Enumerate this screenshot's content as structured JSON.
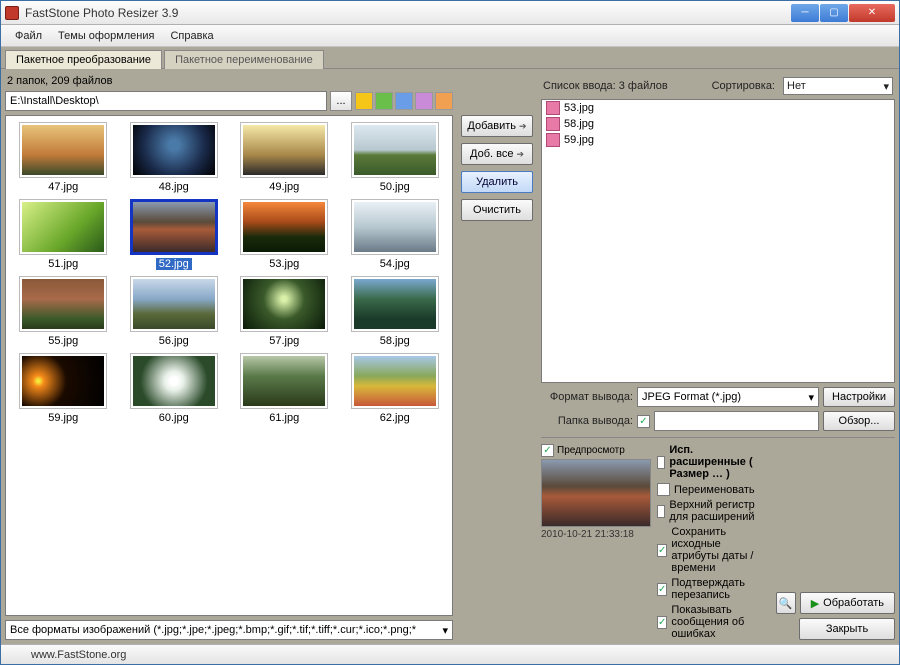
{
  "app": {
    "title": "FastStone Photo Resizer 3.9"
  },
  "menu": {
    "file": "Файл",
    "themes": "Темы оформления",
    "help": "Справка"
  },
  "tabs": {
    "batch_convert": "Пакетное преобразование",
    "batch_rename": "Пакетное переименование"
  },
  "left": {
    "folder_count": "2 папок, 209 файлов",
    "path": "E:\\Install\\Desktop\\",
    "browse_ellipsis": "...",
    "file_types": "Все форматы изображений (*.jpg;*.jpe;*.jpeg;*.bmp;*.gif;*.tif;*.tiff;*.cur;*.ico;*.png;*",
    "thumbs": [
      {
        "name": "47.jpg",
        "cls": "g-sunset1"
      },
      {
        "name": "48.jpg",
        "cls": "g-earth"
      },
      {
        "name": "49.jpg",
        "cls": "g-sky1"
      },
      {
        "name": "50.jpg",
        "cls": "g-field1"
      },
      {
        "name": "51.jpg",
        "cls": "g-leaf1"
      },
      {
        "name": "52.jpg",
        "cls": "g-mount",
        "selected": true
      },
      {
        "name": "53.jpg",
        "cls": "g-sunset2"
      },
      {
        "name": "54.jpg",
        "cls": "g-snow"
      },
      {
        "name": "55.jpg",
        "cls": "g-canyon"
      },
      {
        "name": "56.jpg",
        "cls": "g-farm"
      },
      {
        "name": "57.jpg",
        "cls": "g-cave"
      },
      {
        "name": "58.jpg",
        "cls": "g-valley"
      },
      {
        "name": "59.jpg",
        "cls": "g-space"
      },
      {
        "name": "60.jpg",
        "cls": "g-flower"
      },
      {
        "name": "61.jpg",
        "cls": "g-forest"
      },
      {
        "name": "62.jpg",
        "cls": "g-meadow"
      }
    ]
  },
  "mid": {
    "add": "Добавить",
    "add_all": "Доб. все",
    "remove": "Удалить",
    "clear": "Очистить"
  },
  "right": {
    "list_label": "Список ввода:  3 файлов",
    "sort_label": "Сортировка:",
    "sort_value": "Нет",
    "files": [
      "53.jpg",
      "58.jpg",
      "59.jpg"
    ],
    "format_label": "Формат вывода:",
    "format_value": "JPEG Format (*.jpg)",
    "settings_btn": "Настройки",
    "folder_label": "Папка вывода:",
    "folder_checked": true,
    "folder_value": "",
    "browse_btn": "Обзор...",
    "preview_label": "Предпросмотр",
    "preview_ts": "2010-10-21 21:33:18",
    "opts": {
      "advanced": "Исп. расширенные ( Размер … )",
      "rename": "Переименовать",
      "uppercase_ext": "Верхний регистр для расширений",
      "keep_dates": "Сохранить исходные атрибуты даты / времени",
      "confirm_overwrite": "Подтверждать перезапись",
      "show_errors": "Показывать сообщения об ошибках"
    },
    "convert_btn": "Обработать",
    "close_btn": "Закрыть"
  },
  "status": {
    "url": "www.FastStone.org"
  }
}
